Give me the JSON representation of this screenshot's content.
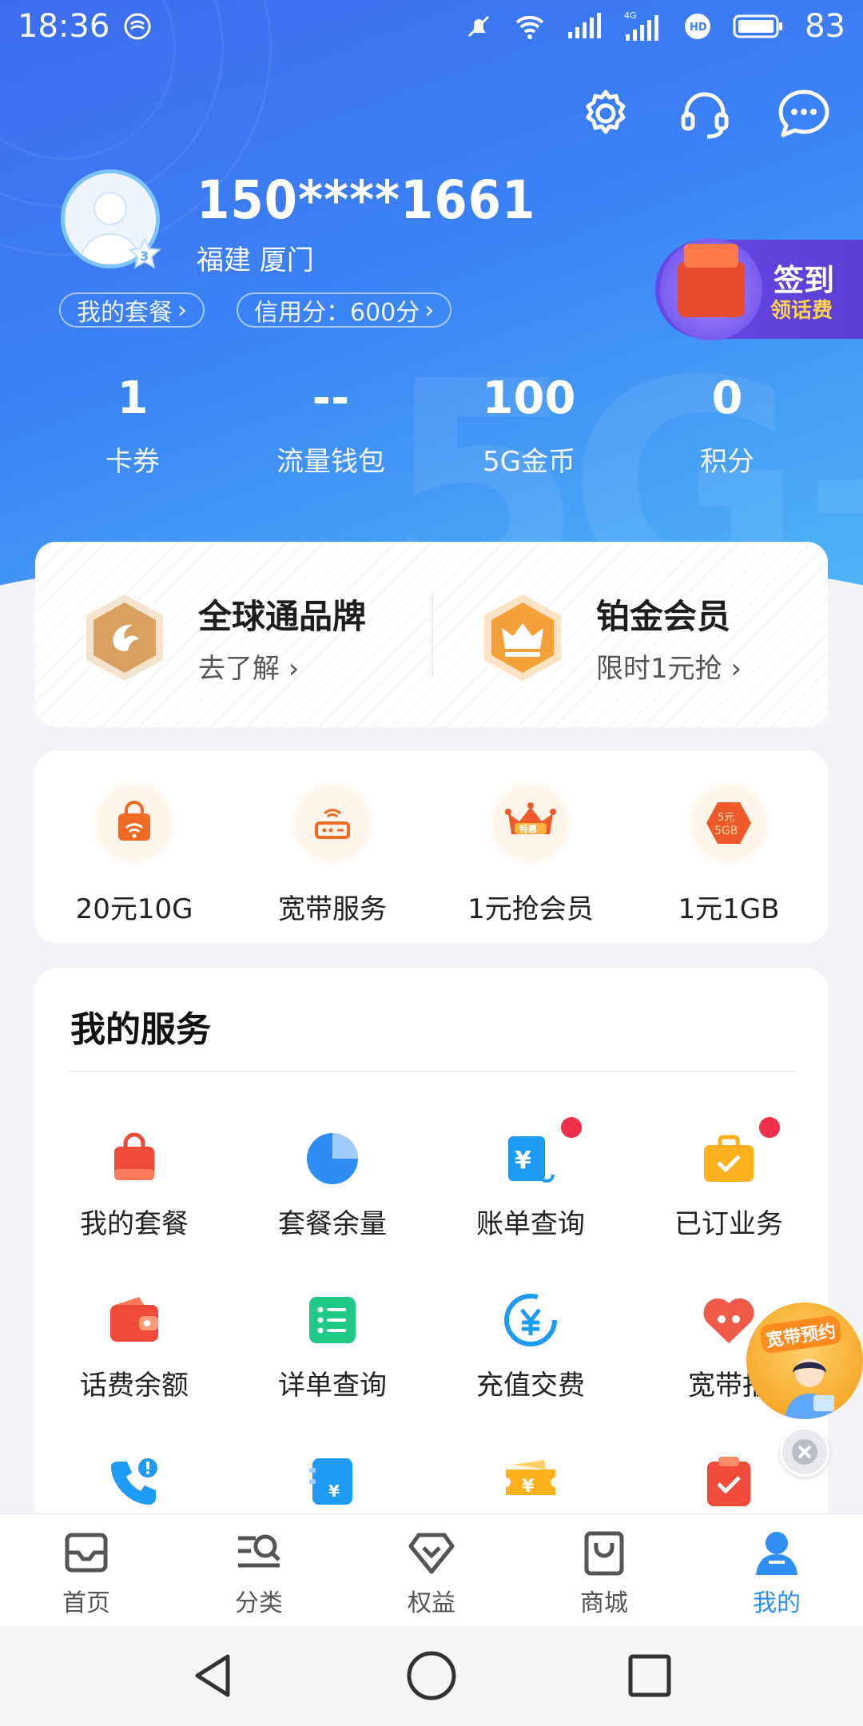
{
  "status_bar": {
    "time": "18:36",
    "battery": "83",
    "network": "4G"
  },
  "header": {
    "icons": [
      "gear-icon",
      "headset-icon",
      "chat-icon"
    ]
  },
  "profile": {
    "phone": "150****1661",
    "location": "福建  厦门",
    "level": "3",
    "my_plan_label": "我的套餐",
    "credit_label": "信用分：600分"
  },
  "signin": {
    "title": "签到",
    "subtitle": "领话费"
  },
  "stats": [
    {
      "value": "1",
      "label": "卡券"
    },
    {
      "value": "--",
      "label": "流量钱包"
    },
    {
      "value": "100",
      "label": "5G金币"
    },
    {
      "value": "0",
      "label": "积分"
    }
  ],
  "brand": [
    {
      "title": "全球通品牌",
      "subtitle": "去了解"
    },
    {
      "title": "铂金会员",
      "subtitle": "限时1元抢"
    }
  ],
  "quick": [
    {
      "label": "20元10G",
      "icon": "wifi-bag-icon"
    },
    {
      "label": "宽带服务",
      "icon": "router-icon"
    },
    {
      "label": "1元抢会员",
      "icon": "crown-icon",
      "badge": "特惠"
    },
    {
      "label": "1元1GB",
      "icon": "data-hexagon-icon",
      "badge_top": "5元",
      "badge_bottom": "5GB"
    }
  ],
  "services": {
    "title": "我的服务",
    "items": [
      {
        "label": "我的套餐",
        "icon": "bag-icon"
      },
      {
        "label": "套餐余量",
        "icon": "pie-chart-icon"
      },
      {
        "label": "账单查询",
        "icon": "bill-icon",
        "dot": true
      },
      {
        "label": "已订业务",
        "icon": "briefcase-icon",
        "dot": true
      },
      {
        "label": "话费余额",
        "icon": "wallet-icon"
      },
      {
        "label": "详单查询",
        "icon": "list-icon"
      },
      {
        "label": "充值交费",
        "icon": "recharge-icon"
      },
      {
        "label": "宽带报",
        "icon": "heart-icon"
      },
      {
        "label": "",
        "icon": "phone-alert-icon"
      },
      {
        "label": "",
        "icon": "card-yen-icon"
      },
      {
        "label": "",
        "icon": "ticket-yen-icon"
      },
      {
        "label": "",
        "icon": "clipboard-check-icon"
      }
    ]
  },
  "float_ad": {
    "label": "宽带预约"
  },
  "tabs": [
    {
      "label": "首页",
      "icon": "home-icon"
    },
    {
      "label": "分类",
      "icon": "category-search-icon"
    },
    {
      "label": "权益",
      "icon": "diamond-icon"
    },
    {
      "label": "商城",
      "icon": "shopping-bag-icon"
    },
    {
      "label": "我的",
      "icon": "user-icon",
      "active": true
    }
  ],
  "colors": {
    "brand_blue": "#3b82f6",
    "active_tab": "#2f8ff5",
    "red_dot": "#f0304a",
    "signin_bg": "#6a47e8"
  }
}
